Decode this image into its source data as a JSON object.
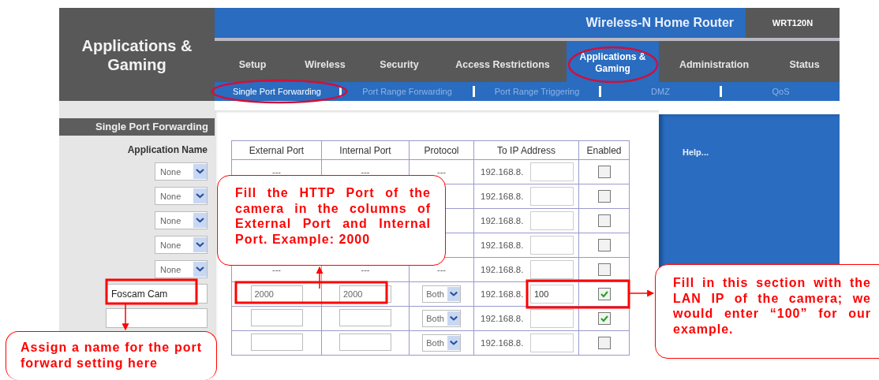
{
  "header": {
    "section_title": "Applications & Gaming",
    "product_name": "Wireless-N Home Router",
    "model": "WRT120N"
  },
  "tabs": [
    {
      "label": "Setup",
      "selected": false
    },
    {
      "label": "Wireless",
      "selected": false
    },
    {
      "label": "Security",
      "selected": false
    },
    {
      "label": "Access Restrictions",
      "selected": false
    },
    {
      "label": "Applications & Gaming",
      "selected": true
    },
    {
      "label": "Administration",
      "selected": false
    },
    {
      "label": "Status",
      "selected": false
    }
  ],
  "subtabs": [
    {
      "label": "Single Port Forwarding",
      "selected": true
    },
    {
      "label": "Port Range Forwarding",
      "selected": false
    },
    {
      "label": "Port Range Triggering",
      "selected": false
    },
    {
      "label": "DMZ",
      "selected": false
    },
    {
      "label": "QoS",
      "selected": false
    }
  ],
  "sidebar": {
    "title": "Single Port Forwarding",
    "label": "Application Name",
    "rows": [
      {
        "kind": "select",
        "value": "None"
      },
      {
        "kind": "select",
        "value": "None"
      },
      {
        "kind": "select",
        "value": "None"
      },
      {
        "kind": "select",
        "value": "None"
      },
      {
        "kind": "select",
        "value": "None"
      },
      {
        "kind": "text",
        "value": "Foscam Cam"
      },
      {
        "kind": "text"
      }
    ]
  },
  "table": {
    "columns": [
      "External Port",
      "Internal Port",
      "Protocol",
      "To IP Address",
      "Enabled"
    ],
    "rows": [
      {
        "kind": "fixed",
        "external_port": "---",
        "internal_port": "---",
        "protocol": "---",
        "ip_prefix": "192.168.8.",
        "enabled": false
      },
      {
        "kind": "fixed",
        "ip_prefix": "192.168.8.",
        "enabled": false
      },
      {
        "kind": "fixed",
        "ip_prefix": "192.168.8.",
        "enabled": false
      },
      {
        "kind": "fixed",
        "ip_prefix": "192.168.8.",
        "enabled": false
      },
      {
        "kind": "fixed",
        "external_port": "---",
        "internal_port": "---",
        "protocol": "---",
        "ip_prefix": "192.168.8.",
        "enabled": false
      },
      {
        "kind": "editable",
        "external_port": "2000",
        "internal_port": "2000",
        "protocol": "Both",
        "ip_prefix": "192.168.8.",
        "ip_suffix": "100",
        "enabled": true
      },
      {
        "kind": "editable",
        "protocol": "Both",
        "ip_prefix": "192.168.8.",
        "enabled": true
      },
      {
        "kind": "editable",
        "protocol": "Both",
        "ip_prefix": "192.168.8.",
        "enabled": false
      }
    ]
  },
  "help": {
    "title": "Help..."
  },
  "callouts": [
    {
      "text": "Fill the HTTP Port of the camera in the columns of External Port and Internal Port. Example: 2000"
    },
    {
      "text": "Assign a name for the port forward setting here"
    },
    {
      "text": "Fill in this section with the LAN IP of the camera; we would enter “100” for our example."
    }
  ]
}
